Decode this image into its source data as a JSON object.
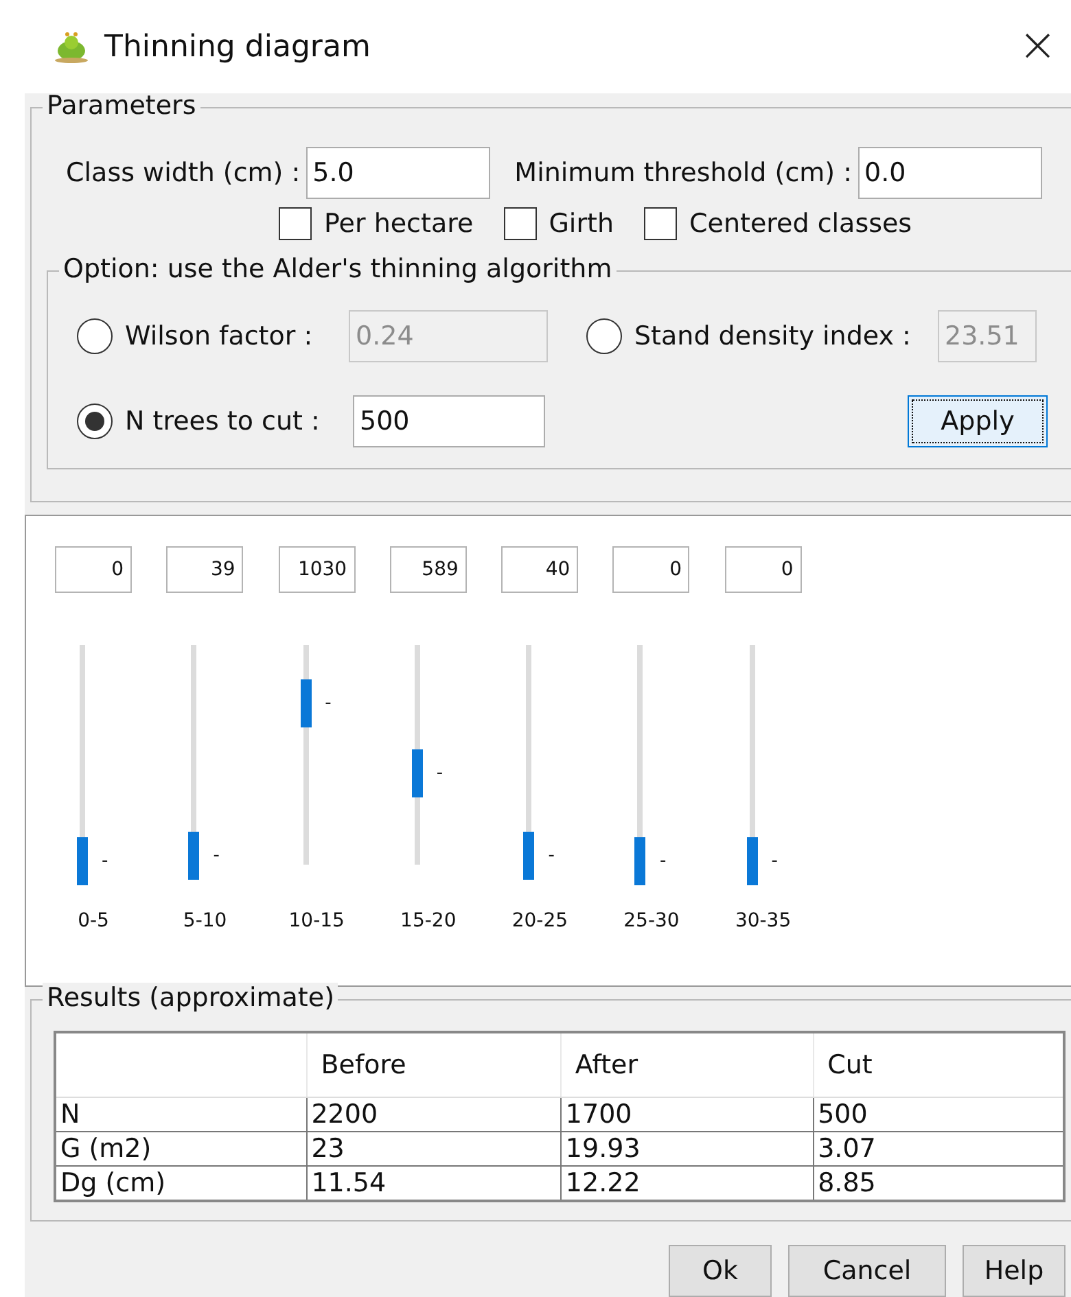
{
  "window": {
    "title": "Thinning diagram",
    "close": "×"
  },
  "parameters": {
    "title": "Parameters",
    "class_width": {
      "label": "Class width (cm) :",
      "value": "5.0"
    },
    "minimum_threshold": {
      "label": "Minimum threshold (cm) :",
      "value": "0.0"
    },
    "checkboxes": [
      {
        "label": "Per hectare",
        "checked": false
      },
      {
        "label": "Girth",
        "checked": false
      },
      {
        "label": "Centered classes",
        "checked": false
      }
    ],
    "alder": {
      "title": "Option: use the Alder's thinning algorithm",
      "options": [
        {
          "label": "Wilson factor :",
          "value": "0.24",
          "selected": false
        },
        {
          "label": "Stand density index :",
          "value": "23.51",
          "selected": false
        },
        {
          "label": "N trees to cut :",
          "value": "500",
          "selected": true
        }
      ],
      "apply_button": "Apply"
    }
  },
  "classes": [
    {
      "count": "0",
      "level": 0,
      "tick": "-",
      "label": "0-5"
    },
    {
      "count": "39",
      "level": 0.03,
      "tick": "-",
      "label": "5-10"
    },
    {
      "count": "1030",
      "level": 0.82,
      "tick": "-",
      "label": "10-15"
    },
    {
      "count": "589",
      "level": 0.46,
      "tick": "-",
      "label": "15-20"
    },
    {
      "count": "40",
      "level": 0.03,
      "tick": "-",
      "label": "20-25"
    },
    {
      "count": "0",
      "level": 0,
      "tick": "-",
      "label": "25-30"
    },
    {
      "count": "0",
      "level": 0,
      "tick": "-",
      "label": "30-35"
    }
  ],
  "results": {
    "title": "Results (approximate)",
    "columns": [
      "Before",
      "After",
      "Cut"
    ],
    "rows": [
      {
        "label": "N",
        "values": [
          "2200",
          "1700",
          "500"
        ]
      },
      {
        "label": "G (m2)",
        "values": [
          "23",
          "19.93",
          "3.07"
        ]
      },
      {
        "label": "Dg (cm)",
        "values": [
          "11.54",
          "12.22",
          "8.85"
        ]
      }
    ]
  },
  "buttons": [
    "Ok",
    "Cancel",
    "Help"
  ]
}
